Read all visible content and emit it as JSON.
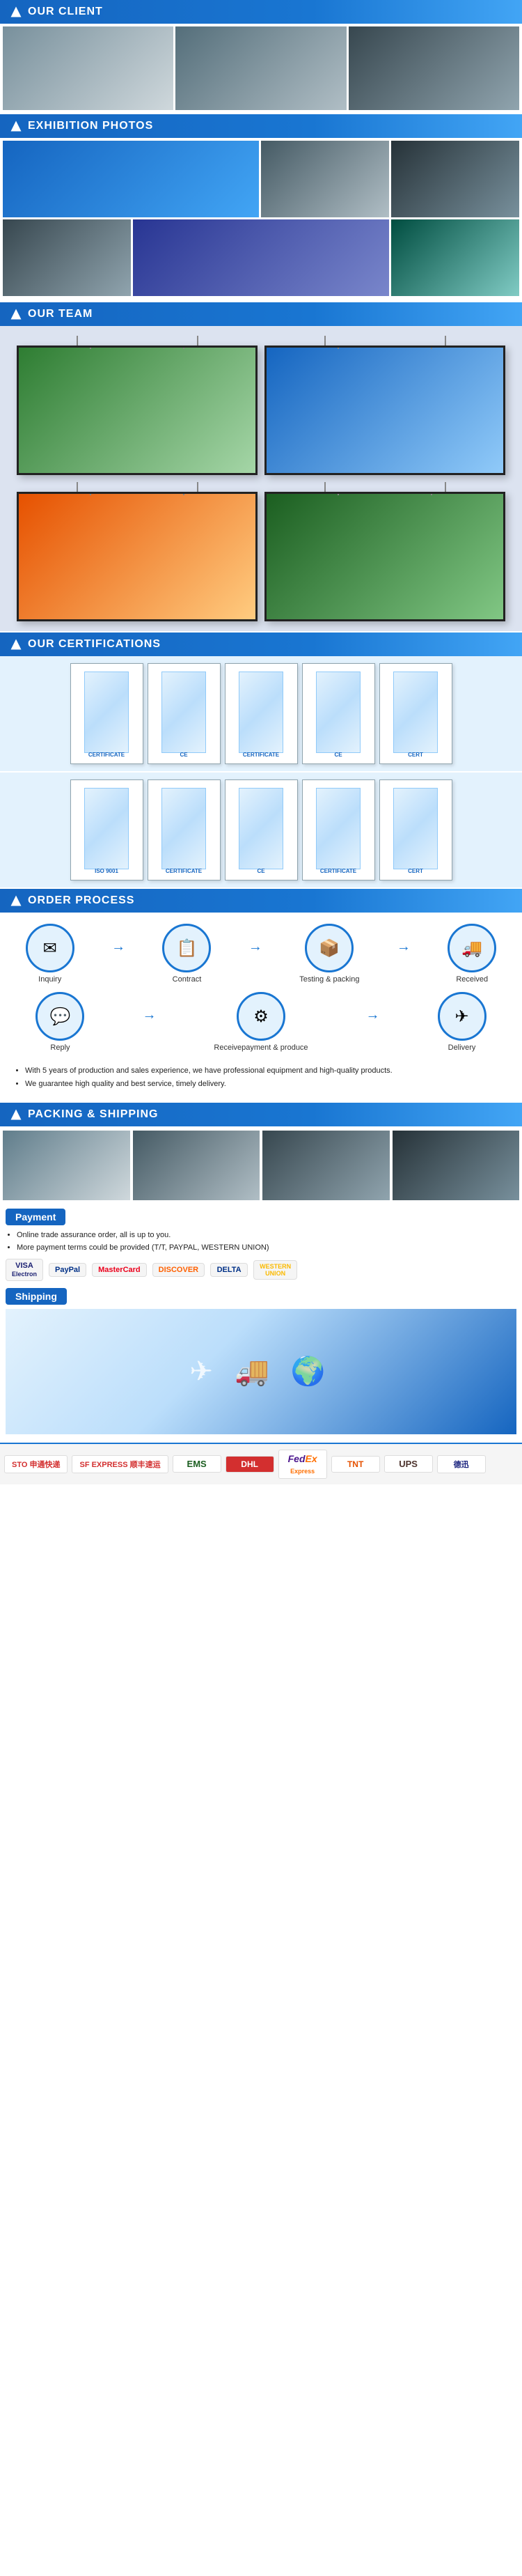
{
  "sections": {
    "our_client": {
      "header": "OUR CLIENT",
      "photos": [
        "client-photo-1",
        "client-photo-2",
        "client-photo-3"
      ]
    },
    "exhibition_photos": {
      "header": "EXHIBITION PHOTOS",
      "row1": [
        "exh1",
        "exh2",
        "exh3"
      ],
      "row2": [
        "exh4",
        "exh5",
        "exh6"
      ]
    },
    "our_team": {
      "header": "OUR TEAM",
      "frames": [
        "team-frame-1",
        "team-frame-2",
        "team-frame-3",
        "team-frame-4"
      ]
    },
    "our_certifications": {
      "header": "OUR CERTIFICATIONS",
      "row1": [
        "cert1",
        "cert2",
        "cert3",
        "cert4",
        "cert5"
      ],
      "row2": [
        "cert6",
        "cert7",
        "cert8",
        "cert9",
        "cert10"
      ]
    },
    "order_process": {
      "header": "ORDER PROCESS",
      "row1_items": [
        {
          "label": "Inquiry",
          "icon": "✉"
        },
        {
          "label": "Contract",
          "icon": "📋"
        },
        {
          "label": "Testing & packing",
          "icon": "📦"
        },
        {
          "label": "Received",
          "icon": "🚚"
        }
      ],
      "row2_items": [
        {
          "label": "Reply",
          "icon": "💬"
        },
        {
          "label": "Receivepayment & produce",
          "icon": "⚙"
        },
        {
          "label": "Delivery",
          "icon": "✈"
        }
      ],
      "bullets": [
        "With 5 years of production and sales experience, we have professional equipment and high-quality products.",
        "We guarantee high quality and best service, timely delivery."
      ]
    },
    "packing_shipping": {
      "header": "PACKING & SHIPPING",
      "payment_label": "Payment",
      "shipping_label": "Shipping",
      "payment_bullets": [
        "Online trade assurance order, all is up to you.",
        "More payment terms could be provided (T/T, PAYPAL, WESTERN UNION)"
      ],
      "payment_logos": [
        "VISA\nElectron",
        "PayPal",
        "MasterCard",
        "DISCOVER",
        "DELTA",
        "WESTERN\nUNION"
      ],
      "courier_logos": [
        {
          "name": "STO 申通快递",
          "class": "sto"
        },
        {
          "name": "SF EXPRESS 顺丰速运",
          "class": "sf"
        },
        {
          "name": "EMS",
          "class": "ems"
        },
        {
          "name": "DHL",
          "class": "dhl"
        },
        {
          "name": "FedEx\nExpress",
          "class": "fedex"
        },
        {
          "name": "TNT",
          "class": "tnt"
        },
        {
          "name": "UPS",
          "class": "ups"
        },
        {
          "name": "德迅",
          "class": "dejl"
        }
      ]
    }
  }
}
